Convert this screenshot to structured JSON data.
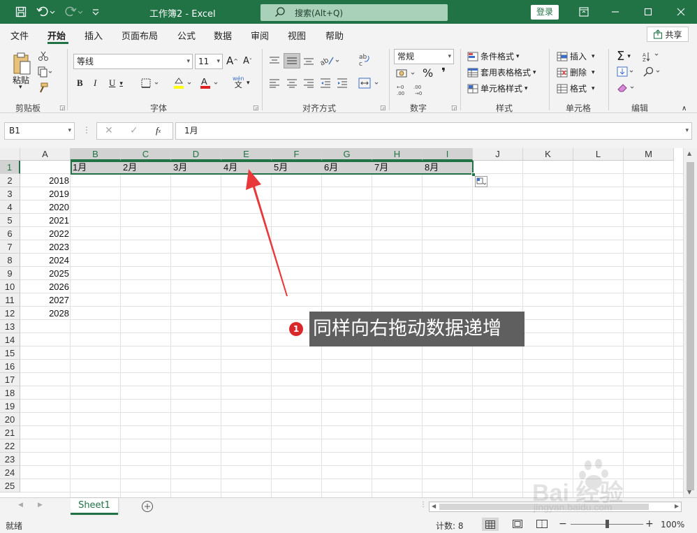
{
  "window": {
    "title": "工作簿2 - Excel",
    "search_placeholder": "搜索(Alt+Q)",
    "login": "登录",
    "accent": "#217346"
  },
  "menu": {
    "tabs": [
      "文件",
      "开始",
      "插入",
      "页面布局",
      "公式",
      "数据",
      "审阅",
      "视图",
      "帮助"
    ],
    "active": "开始",
    "share": "共享"
  },
  "ribbon": {
    "clipboard": {
      "label": "剪贴板",
      "paste": "粘贴"
    },
    "font": {
      "label": "字体",
      "font_name": "等线",
      "font_size": "11",
      "phonetic_top": "wén",
      "phonetic_bottom": "文"
    },
    "alignment": {
      "label": "对齐方式",
      "wrap": "ab\nc"
    },
    "number": {
      "label": "数字",
      "format": "常规"
    },
    "styles": {
      "label": "样式",
      "conditional": "条件格式",
      "table": "套用表格格式",
      "cell_styles": "单元格样式"
    },
    "cells": {
      "label": "单元格",
      "insert": "插入",
      "delete": "删除",
      "format": "格式"
    },
    "editing": {
      "label": "编辑"
    }
  },
  "formula_bar": {
    "name_box": "B1",
    "value": "1月"
  },
  "sheet": {
    "columns": [
      "A",
      "B",
      "C",
      "D",
      "E",
      "F",
      "G",
      "H",
      "I",
      "J",
      "K",
      "L",
      "M"
    ],
    "rows": [
      "1",
      "2",
      "3",
      "4",
      "5",
      "6",
      "7",
      "8",
      "9",
      "10",
      "11",
      "12",
      "13",
      "14",
      "15",
      "16",
      "17",
      "18",
      "19",
      "20",
      "21",
      "22",
      "23",
      "24",
      "25"
    ],
    "row1_months": [
      "1月",
      "2月",
      "3月",
      "4月",
      "5月",
      "6月",
      "7月",
      "8月"
    ],
    "years": [
      "2018",
      "2019",
      "2020",
      "2021",
      "2022",
      "2023",
      "2024",
      "2025",
      "2026",
      "2027",
      "2028"
    ],
    "tab": "Sheet1"
  },
  "status": {
    "ready": "就绪",
    "count": "计数: 8",
    "zoom": "100%"
  },
  "annotation": {
    "number": "1",
    "text": "同样向右拖动数据递增"
  },
  "watermark": {
    "line1": "Bai 经验",
    "line2": "jingyan.baidu.com"
  }
}
